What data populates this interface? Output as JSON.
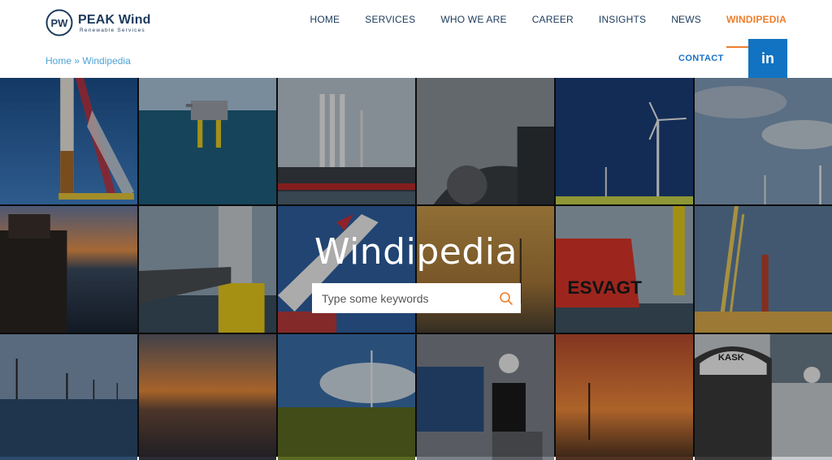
{
  "brand": {
    "name": "PEAK Wind",
    "tagline": "Renewable Services",
    "monogram": "PW"
  },
  "nav": {
    "items": [
      {
        "label": "HOME"
      },
      {
        "label": "SERVICES"
      },
      {
        "label": "WHO WE ARE"
      },
      {
        "label": "CAREER"
      },
      {
        "label": "INSIGHTS"
      },
      {
        "label": "NEWS"
      },
      {
        "label": "WINDIPEDIA"
      }
    ],
    "active": "WINDIPEDIA",
    "active_color": "#ef7d2a",
    "contact_label": "CONTACT"
  },
  "breadcrumb": {
    "home": "Home",
    "separator": "»",
    "current": "Windipedia"
  },
  "social": {
    "linkedin_label": "in",
    "linkedin_color": "#1173c1"
  },
  "hero": {
    "title": "Windipedia",
    "search_placeholder": "Type some keywords",
    "search_value": ""
  },
  "gallery": {
    "tiles": [
      {
        "subject": "installation-crane"
      },
      {
        "subject": "offshore-substation"
      },
      {
        "subject": "jackup-vessel-towers"
      },
      {
        "subject": "nacelle-closeup"
      },
      {
        "subject": "wind-turbine-field"
      },
      {
        "subject": "turbines-cloudy-sky"
      },
      {
        "subject": "platform-sunset"
      },
      {
        "subject": "access-gangway"
      },
      {
        "subject": "rotor-blade"
      },
      {
        "subject": "turbines-dusk"
      },
      {
        "subject": "esvagt-vessel",
        "printed_text": "ESVAGT"
      },
      {
        "subject": "crane-vessel"
      },
      {
        "subject": "offshore-turbines-row"
      },
      {
        "subject": "sea-sunset"
      },
      {
        "subject": "sunflower-field"
      },
      {
        "subject": "technician-nacelle"
      },
      {
        "subject": "orange-sunset-turbines"
      },
      {
        "subject": "technicians-selfie",
        "printed_text": "KASK"
      }
    ]
  }
}
